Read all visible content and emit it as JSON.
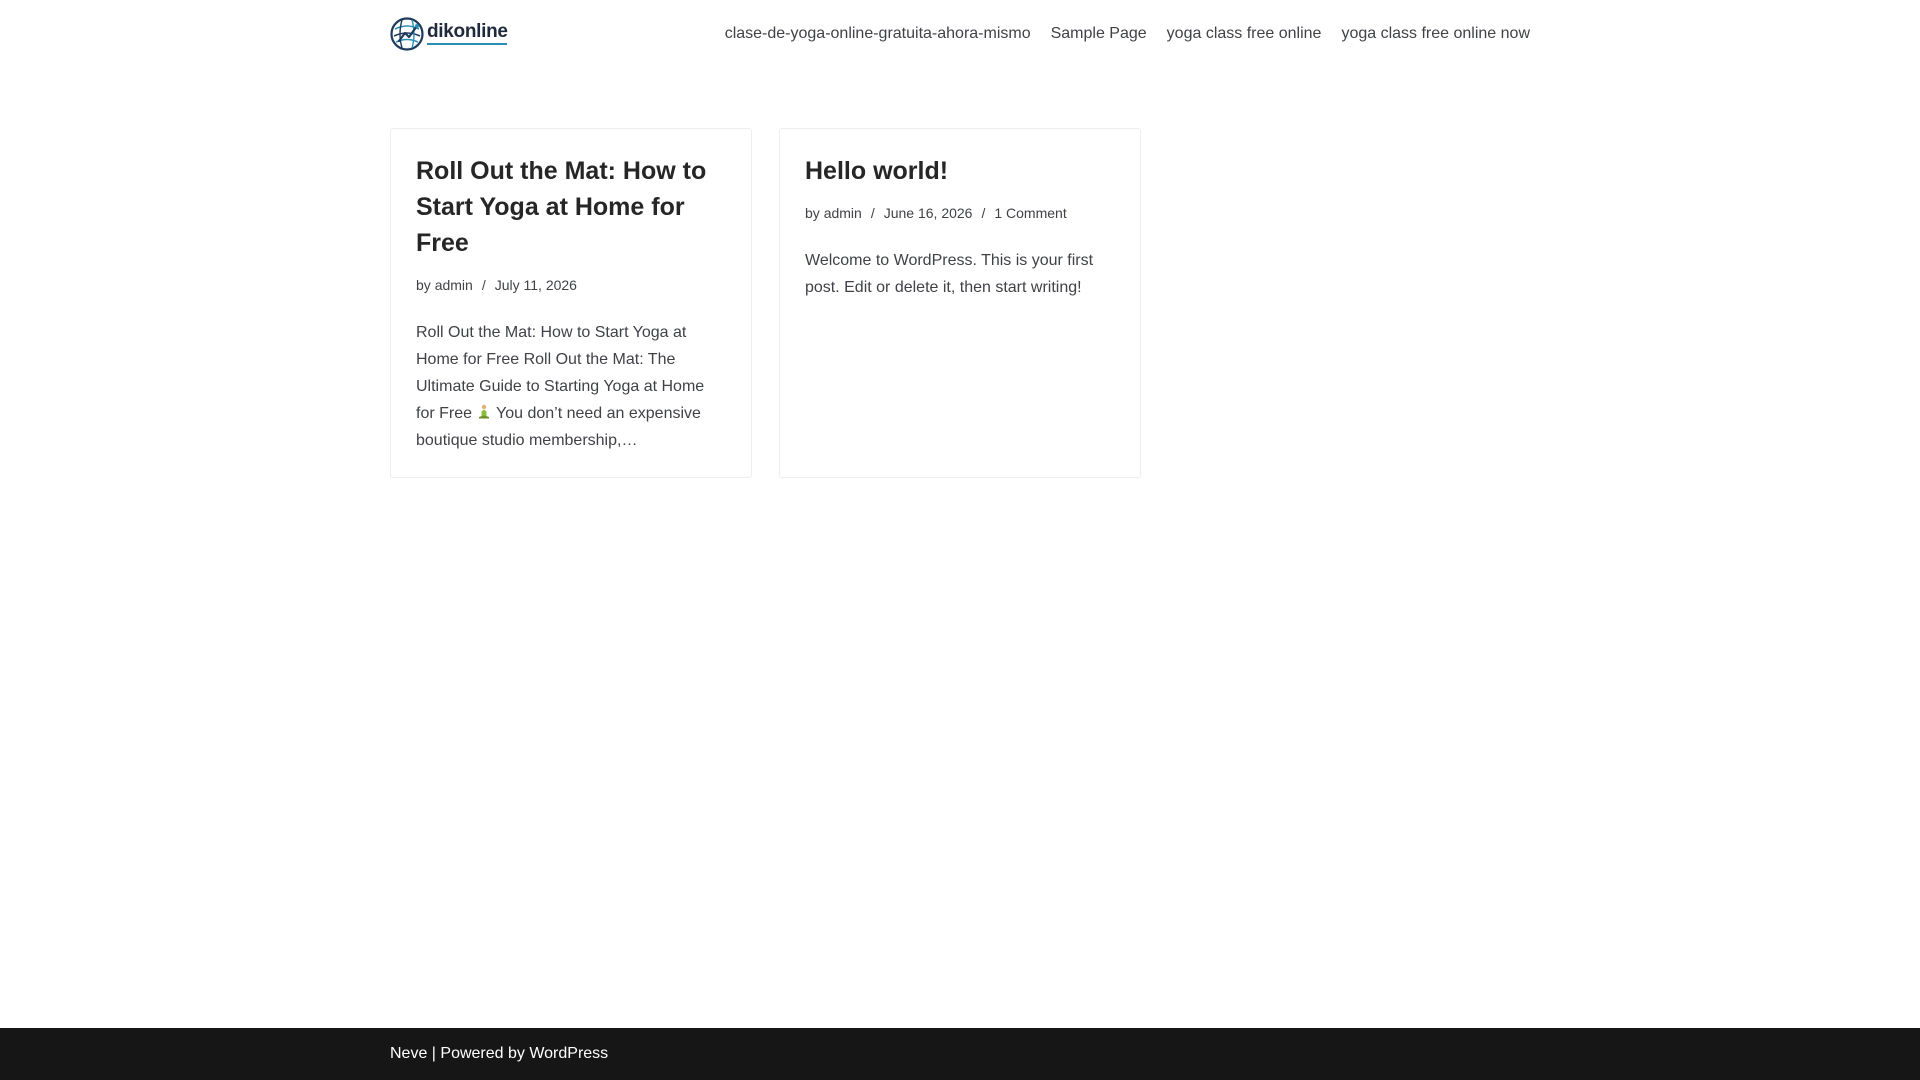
{
  "site": {
    "logo_name": "dikonline"
  },
  "nav": {
    "items": [
      {
        "label": "clase-de-yoga-online-gratuita-ahora-mismo"
      },
      {
        "label": "Sample Page"
      },
      {
        "label": "yoga class free online"
      },
      {
        "label": "yoga class free online now"
      }
    ]
  },
  "posts": [
    {
      "title": "Roll Out the Mat: How to Start Yoga at Home for Free",
      "by_prefix": "by",
      "author": "admin",
      "separator": "/",
      "date": "July 11, 2026",
      "excerpt_before_emoji": "Roll Out the Mat: How to Start Yoga at Home for Free Roll Out the Mat: The Ultimate Guide to Starting Yoga at Home for Free",
      "excerpt_emoji_icon": "person-in-lotus-position-icon",
      "excerpt_after_emoji": "You don’t need an expensive boutique studio membership,…"
    },
    {
      "title": "Hello world!",
      "by_prefix": "by",
      "author": "admin",
      "separator": "/",
      "date": "June 16, 2026",
      "comments": "1 Comment",
      "excerpt": "Welcome to WordPress. This is your first post. Edit or delete it, then start writing!"
    }
  ],
  "footer": {
    "theme_link": "Neve",
    "middle_text": " | Powered by ",
    "wp_link": "WordPress"
  },
  "colors": {
    "footer_bg": "#161616",
    "text": "#272626",
    "card_border": "#eeeeee",
    "logo_accent": "#2b8fb5"
  }
}
